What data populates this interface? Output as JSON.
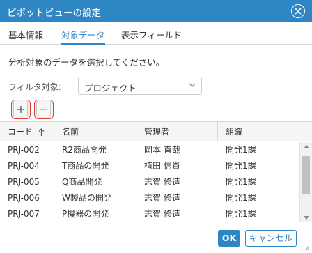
{
  "dialog": {
    "title": "ピボットビューの設定"
  },
  "tabs": [
    {
      "label": "基本情報",
      "active": false
    },
    {
      "label": "対象データ",
      "active": true
    },
    {
      "label": "表示フィールド",
      "active": false
    }
  ],
  "instruction": "分析対象のデータを選択してください。",
  "filter": {
    "label": "フィルタ対象:",
    "selected": "プロジェクト"
  },
  "grid": {
    "columns": [
      "コード",
      "名前",
      "管理者",
      "組織"
    ],
    "sort": {
      "column": "コード",
      "direction": "ascending"
    },
    "rows": [
      {
        "code": "PRJ-002",
        "name": "R2商品開発",
        "manager": "岡本 直哉",
        "org": "開発1課"
      },
      {
        "code": "PRJ-004",
        "name": "T商品の開発",
        "manager": "植田 信貴",
        "org": "開発1課"
      },
      {
        "code": "PRJ-005",
        "name": "Q商品開発",
        "manager": "志賀 修造",
        "org": "開発1課"
      },
      {
        "code": "PRJ-006",
        "name": "W製品の開発",
        "manager": "志賀 修造",
        "org": "開発1課"
      },
      {
        "code": "PRJ-007",
        "name": "P機器の開発",
        "manager": "志賀 修造",
        "org": "開発1課"
      }
    ]
  },
  "buttons": {
    "ok": "OK",
    "cancel": "キャンセル"
  },
  "colors": {
    "accent": "#2f86c4",
    "highlight_border": "#e0403a"
  },
  "icons": [
    "close-icon",
    "add-icon",
    "remove-icon",
    "chevron-down-icon",
    "sort-ascending-icon",
    "scroll-up-icon",
    "scroll-down-icon",
    "resize-grip-icon"
  ]
}
